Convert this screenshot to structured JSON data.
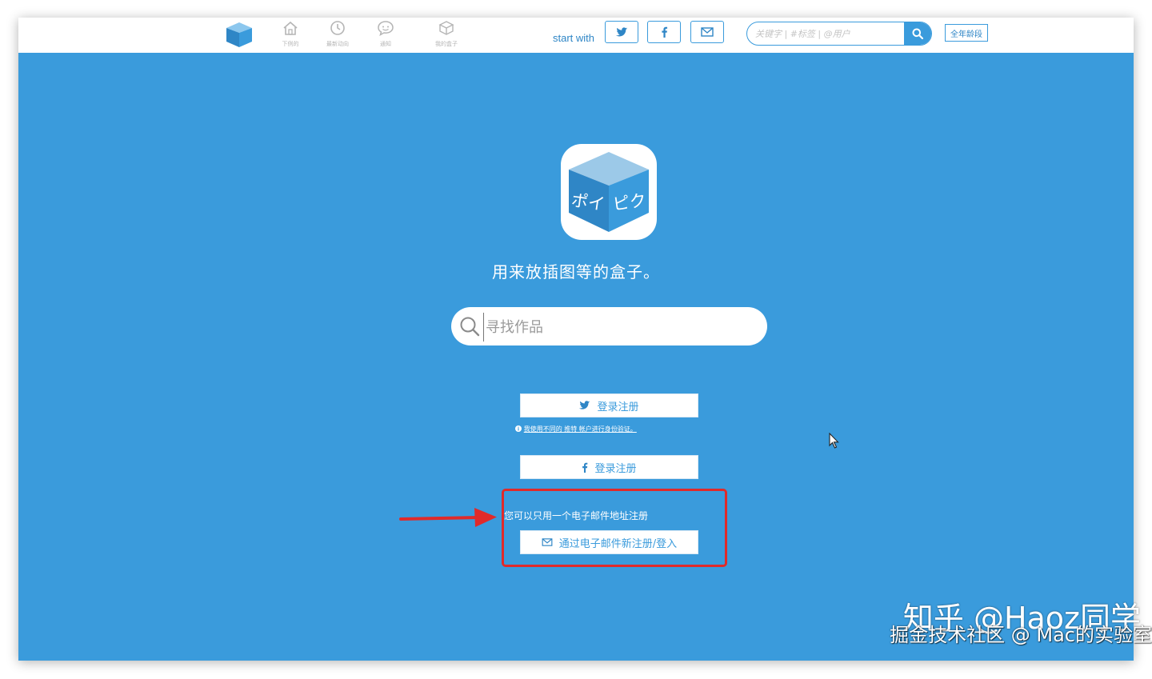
{
  "nav": {
    "logo_text": "ポイピク",
    "items": [
      {
        "label": "下例的",
        "icon": "home-icon"
      },
      {
        "label": "最新动向",
        "icon": "clock-icon"
      },
      {
        "label": "通知",
        "icon": "chat-bubble-icon"
      },
      {
        "label": "我的盒子",
        "icon": "box-icon"
      }
    ],
    "start_with": "start with",
    "search_placeholder": "关键字 | #标签 | @用户",
    "age_filter": "全年龄段"
  },
  "hero": {
    "logo_text": "ポイピク",
    "tagline": "用来放插图等的盒子。",
    "search_placeholder": "寻找作品"
  },
  "auth": {
    "twitter_login": "登录注册",
    "twitter_note": "我使用不同的 推特 帐户进行身份验证。",
    "facebook_login": "登录注册",
    "email_note": "您可以只用一个电子邮件地址注册",
    "email_login": "通过电子邮件新注册/登入"
  },
  "watermark": {
    "line1": "知乎 @Haoz同学",
    "line2": "掘金技术社区 @ Mac的实验室"
  },
  "colors": {
    "brand_blue": "#3a9bdc",
    "highlight_red": "#e02a2a"
  }
}
